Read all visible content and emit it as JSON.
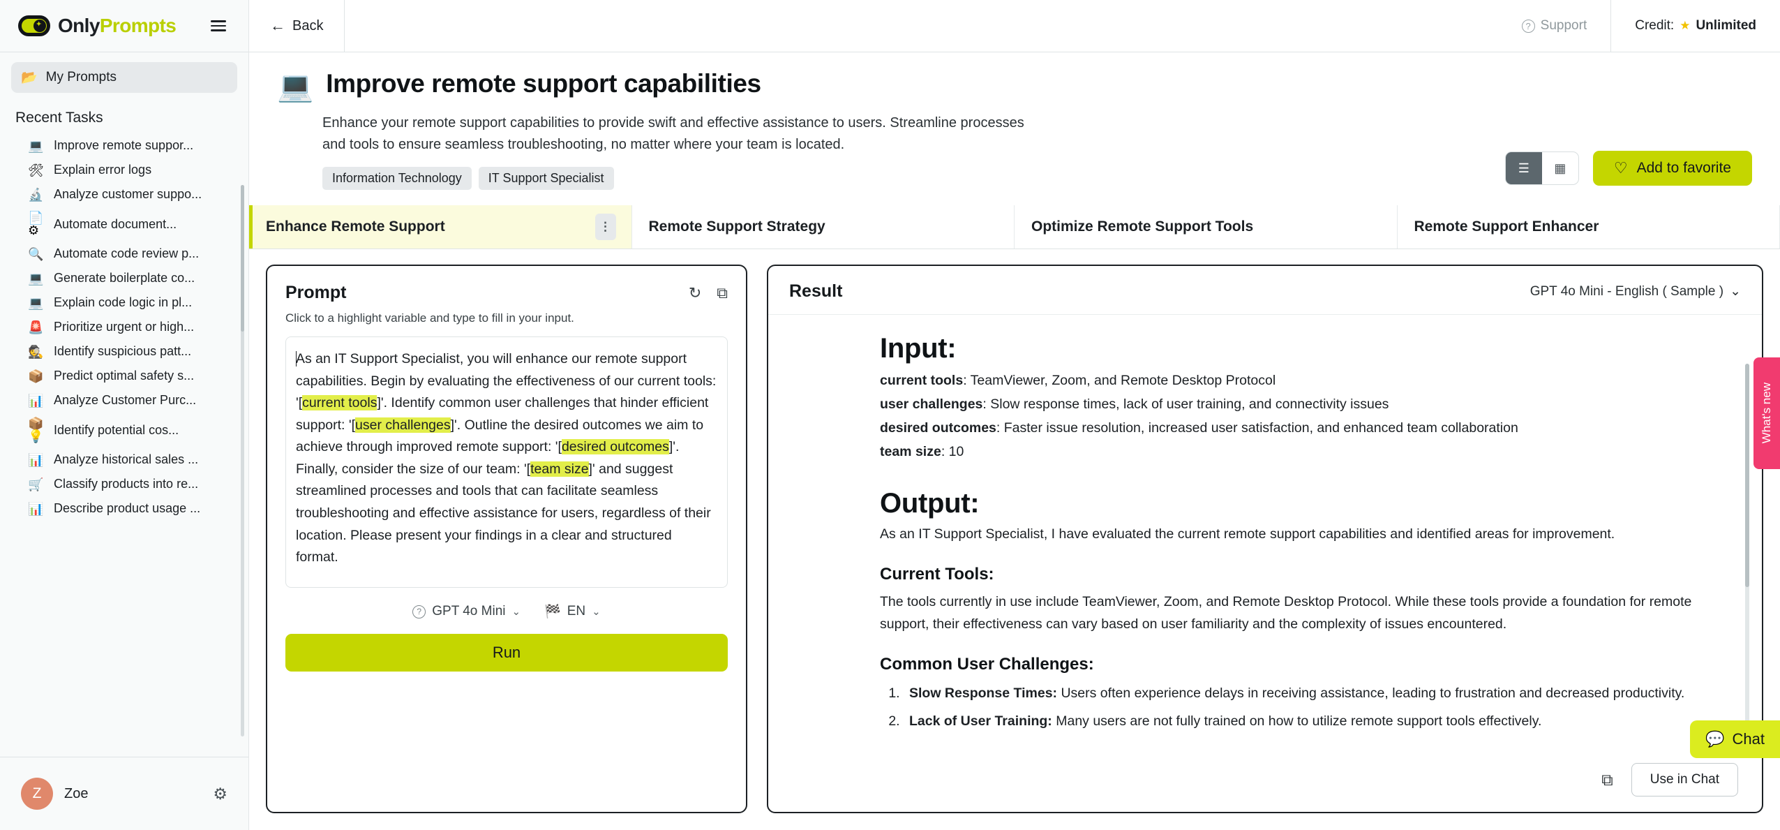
{
  "brand": {
    "name_primary": "Only",
    "name_secondary": "Prompts",
    "accent": "#c4d600"
  },
  "sidebar": {
    "my_prompts": {
      "label": "My Prompts",
      "icon": "📂"
    },
    "section_title": "Recent Tasks",
    "tasks": [
      {
        "icon": "💻",
        "label": "Improve remote suppor..."
      },
      {
        "icon": "🛠",
        "label": "Explain error logs"
      },
      {
        "icon": "🔬",
        "label": "Analyze customer suppo..."
      },
      {
        "icon": "📄⚙",
        "label": "Automate document..."
      },
      {
        "icon": "🔍",
        "label": "Automate code review p..."
      },
      {
        "icon": "💻",
        "label": "Generate boilerplate co..."
      },
      {
        "icon": "💻",
        "label": "Explain code logic in pl..."
      },
      {
        "icon": "🚨",
        "label": "Prioritize urgent or high..."
      },
      {
        "icon": "🕵",
        "label": "Identify suspicious patt..."
      },
      {
        "icon": "📦",
        "label": "Predict optimal safety s..."
      },
      {
        "icon": "📊",
        "label": "Analyze Customer Purc..."
      },
      {
        "icon": "📦💡",
        "label": "Identify potential cos..."
      },
      {
        "icon": "📊",
        "label": "Analyze historical sales ..."
      },
      {
        "icon": "🛒",
        "label": "Classify products into re..."
      },
      {
        "icon": "📊",
        "label": "Describe product usage ..."
      }
    ],
    "user": {
      "initial": "Z",
      "name": "Zoe",
      "settings_icon": "gear-icon"
    }
  },
  "topbar": {
    "back_label": "Back",
    "support_label": "Support",
    "credit_label": "Credit:",
    "credit_value": "Unlimited",
    "credit_star": "★"
  },
  "page": {
    "icon": "💻",
    "title": "Improve remote support capabilities",
    "description": "Enhance your remote support capabilities to provide swift and effective assistance to users. Streamline processes and tools to ensure seamless troubleshooting, no matter where your team is located.",
    "tags": [
      "Information Technology",
      "IT Support Specialist"
    ],
    "view_list": "list-view",
    "view_grid": "grid-view",
    "favorite_label": "Add to favorite",
    "favorite_icon": "♡"
  },
  "tabs": [
    {
      "label": "Enhance Remote Support",
      "active": true,
      "menu": "⋮"
    },
    {
      "label": "Remote Support Strategy",
      "active": false
    },
    {
      "label": "Optimize Remote Support Tools",
      "active": false
    },
    {
      "label": "Remote Support Enhancer",
      "active": false
    }
  ],
  "prompt_panel": {
    "title": "Prompt",
    "refresh_icon": "↻",
    "copy_icon": "⧉",
    "hint": "Click to a highlight variable and type to fill in your input.",
    "text_parts": [
      {
        "t": "As an IT Support Specialist, you will enhance our remote support capabilities. Begin by evaluating the effectiveness of our current tools: '["
      },
      {
        "t": "current tools",
        "hl": true
      },
      {
        "t": "]'. Identify common user challenges that hinder efficient support: '["
      },
      {
        "t": "user challenges",
        "hl": true
      },
      {
        "t": "]'. Outline the desired outcomes we aim to achieve through improved remote support: '["
      },
      {
        "t": "desired outcomes",
        "hl": true
      },
      {
        "t": "]'. Finally, consider the size of our team: '["
      },
      {
        "t": "team size",
        "hl": true
      },
      {
        "t": "]' and suggest streamlined processes and tools that can facilitate seamless troubleshooting and effective assistance for users, regardless of their location. Please present your findings in a clear and structured format."
      }
    ],
    "model_label": "GPT 4o Mini",
    "model_chevron": "⌄",
    "lang_icon": "🏁",
    "lang_label": "EN",
    "lang_chevron": "⌄",
    "run_label": "Run"
  },
  "result_panel": {
    "title": "Result",
    "model_selector": "GPT 4o Mini - English ( Sample )",
    "model_chevron": "⌄",
    "input_heading": "Input:",
    "input_rows": [
      {
        "key": "current tools",
        "value": ": TeamViewer, Zoom, and Remote Desktop Protocol"
      },
      {
        "key": "user challenges",
        "value": ": Slow response times, lack of user training, and connectivity issues"
      },
      {
        "key": "desired outcomes",
        "value": ": Faster issue resolution, increased user satisfaction, and enhanced team collaboration"
      },
      {
        "key": "team size",
        "value": ": 10"
      }
    ],
    "output_heading": "Output:",
    "output_intro": "As an IT Support Specialist, I have evaluated the current remote support capabilities and identified areas for improvement.",
    "section1_heading": "Current Tools:",
    "section1_text": "The tools currently in use include TeamViewer, Zoom, and Remote Desktop Protocol. While these tools provide a foundation for remote support, their effectiveness can vary based on user familiarity and the complexity of issues encountered.",
    "section2_heading": "Common User Challenges:",
    "challenges": [
      {
        "bold": "Slow Response Times:",
        "text": " Users often experience delays in receiving assistance, leading to frustration and decreased productivity."
      },
      {
        "bold": "Lack of User Training:",
        "text": " Many users are not fully trained on how to utilize remote support tools effectively."
      }
    ],
    "copy_icon": "⧉",
    "use_in_chat_label": "Use in Chat"
  },
  "widgets": {
    "whats_new": "What's new",
    "chat_label": "Chat",
    "chat_icon": "💬"
  }
}
